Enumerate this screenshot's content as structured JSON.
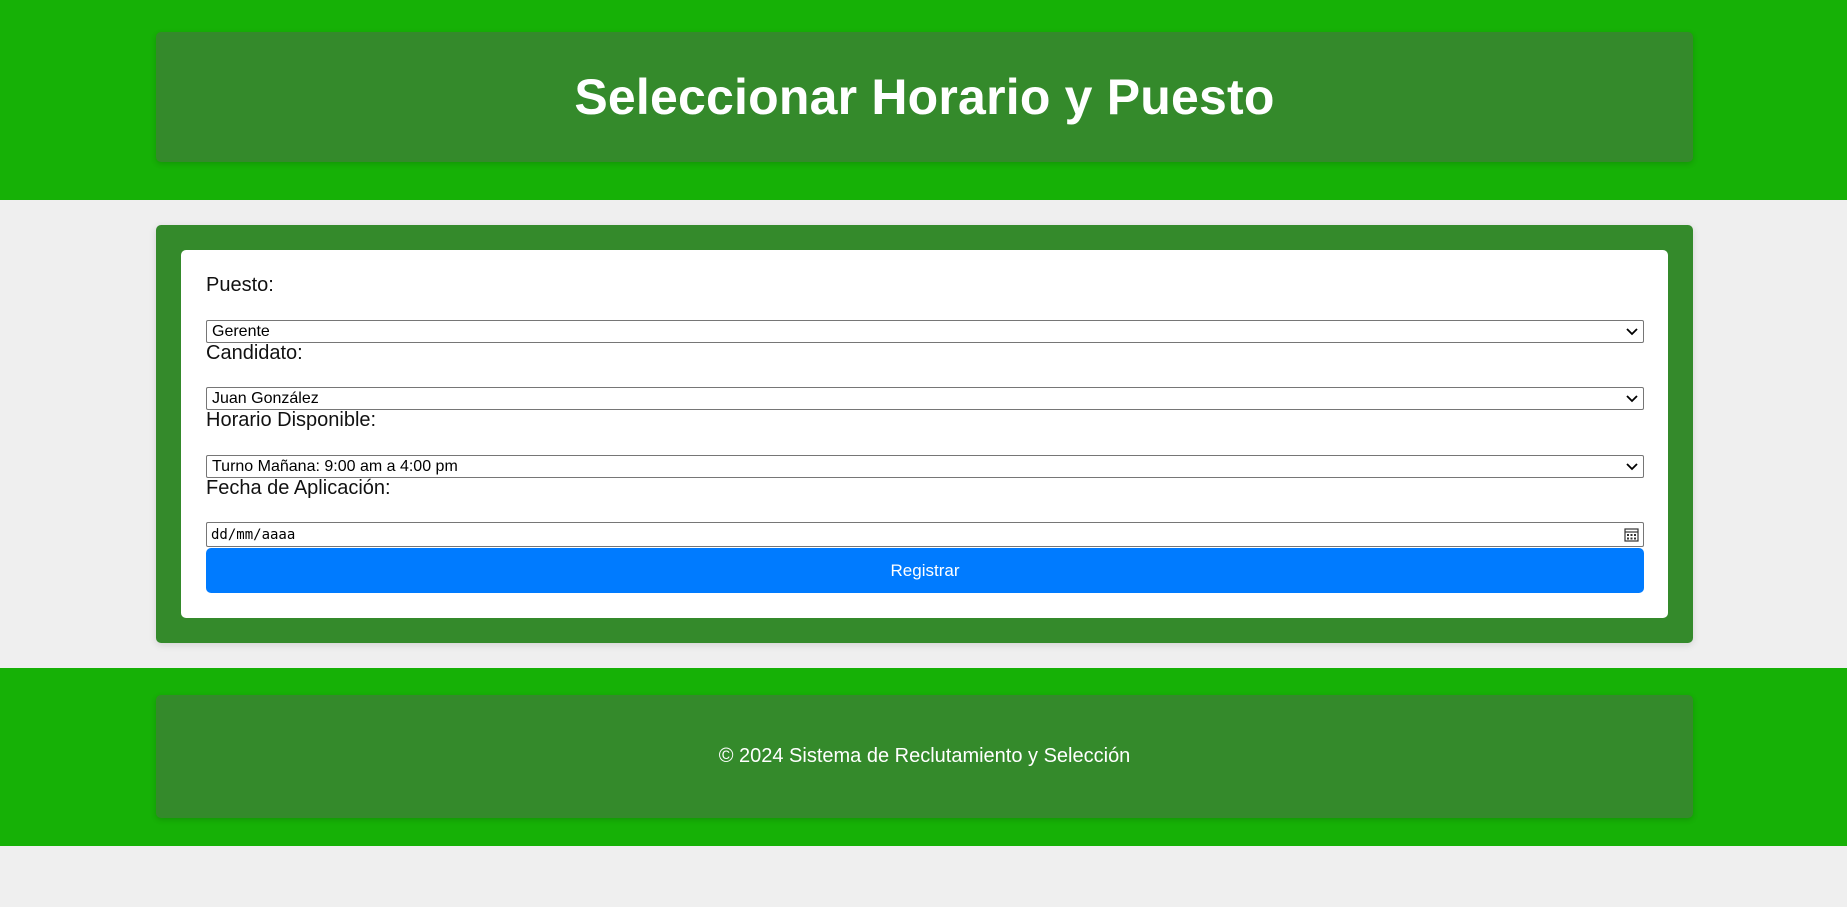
{
  "header": {
    "title": "Seleccionar Horario y Puesto"
  },
  "form": {
    "puesto_label": "Puesto:",
    "puesto_value": "Gerente",
    "candidato_label": "Candidato:",
    "candidato_value": "Juan González",
    "horario_label": "Horario Disponible:",
    "horario_value": "Turno Mañana: 9:00 am a 4:00 pm",
    "fecha_label": "Fecha de Aplicación:",
    "fecha_placeholder": "dd/mm/aaaa",
    "submit_label": "Registrar"
  },
  "footer": {
    "text": "© 2024 Sistema de Reclutamiento y Selección"
  },
  "icons": {
    "select_arrow": "chevron-down-icon",
    "date_picker": "calendar-icon"
  },
  "colors": {
    "band_green": "#16b106",
    "card_green": "#348a2b",
    "button_blue": "#007bff",
    "page_background": "#efefef"
  }
}
